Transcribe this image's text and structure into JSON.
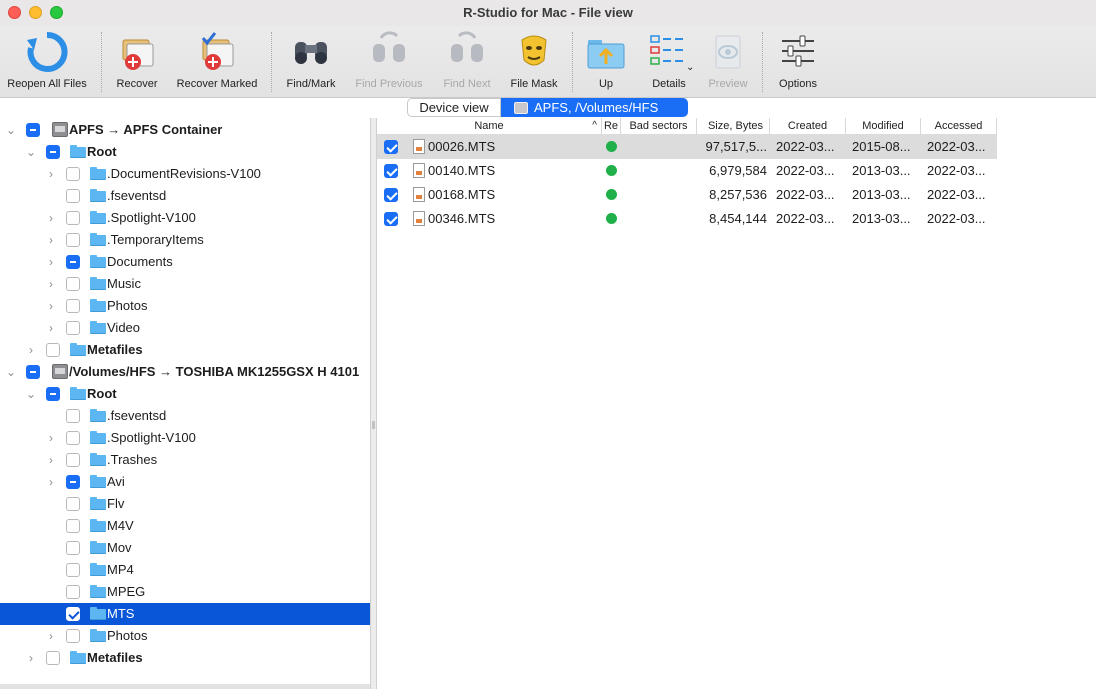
{
  "window": {
    "title": "R-Studio for Mac - File view"
  },
  "toolbar": {
    "reopen_all_files": "Reopen All Files",
    "recover": "Recover",
    "recover_marked": "Recover Marked",
    "find_mark": "Find/Mark",
    "find_previous": "Find Previous",
    "find_next": "Find Next",
    "file_mask": "File Mask",
    "up": "Up",
    "details": "Details",
    "preview": "Preview",
    "options": "Options"
  },
  "tabs": {
    "device_view": "Device view",
    "apfs_volume": "APFS, /Volumes/HFS"
  },
  "tree": [
    {
      "label": "APFS → APFS Container",
      "bold": true,
      "icon": "drive-icon",
      "level": 0,
      "expanded": true,
      "check": "mixed"
    },
    {
      "label": "Root",
      "bold": true,
      "icon": "folder-icon",
      "level": 1,
      "expanded": true,
      "check": "mixed"
    },
    {
      "label": ".DocumentRevisions-V100",
      "icon": "folder-icon",
      "level": 2,
      "expanded": false,
      "check": "none"
    },
    {
      "label": ".fseventsd",
      "icon": "folder-icon",
      "level": 2,
      "check": "none"
    },
    {
      "label": ".Spotlight-V100",
      "icon": "folder-icon",
      "level": 2,
      "expanded": false,
      "check": "none"
    },
    {
      "label": ".TemporaryItems",
      "icon": "folder-icon",
      "level": 2,
      "expanded": false,
      "check": "none"
    },
    {
      "label": "Documents",
      "icon": "folder-icon",
      "level": 2,
      "expanded": false,
      "check": "mixed"
    },
    {
      "label": "Music",
      "icon": "folder-icon",
      "level": 2,
      "expanded": false,
      "check": "none"
    },
    {
      "label": "Photos",
      "icon": "folder-icon",
      "level": 2,
      "expanded": false,
      "check": "none"
    },
    {
      "label": "Video",
      "icon": "folder-icon",
      "level": 2,
      "expanded": false,
      "check": "none"
    },
    {
      "label": "Metafiles",
      "bold": true,
      "icon": "folder-icon",
      "level": 1,
      "expanded": false,
      "check": "none"
    },
    {
      "label": "/Volumes/HFS → TOSHIBA MK1255GSX H 4101",
      "bold": true,
      "icon": "drive-icon",
      "level": 0,
      "expanded": true,
      "check": "mixed"
    },
    {
      "label": "Root",
      "bold": true,
      "icon": "folder-icon",
      "level": 1,
      "expanded": true,
      "check": "mixed"
    },
    {
      "label": ".fseventsd",
      "icon": "folder-icon",
      "level": 2,
      "check": "none"
    },
    {
      "label": ".Spotlight-V100",
      "icon": "folder-icon",
      "level": 2,
      "expanded": false,
      "check": "none"
    },
    {
      "label": ".Trashes",
      "icon": "folder-icon",
      "level": 2,
      "expanded": false,
      "check": "none"
    },
    {
      "label": "Avi",
      "icon": "folder-icon",
      "level": 2,
      "expanded": false,
      "check": "mixed"
    },
    {
      "label": "Flv",
      "icon": "folder-icon",
      "level": 2,
      "check": "none"
    },
    {
      "label": "M4V",
      "icon": "folder-icon",
      "level": 2,
      "check": "none"
    },
    {
      "label": "Mov",
      "icon": "folder-icon",
      "level": 2,
      "check": "none"
    },
    {
      "label": "MP4",
      "icon": "folder-icon",
      "level": 2,
      "check": "none"
    },
    {
      "label": "MPEG",
      "icon": "folder-icon",
      "level": 2,
      "check": "none"
    },
    {
      "label": "MTS",
      "icon": "folder-icon",
      "level": 2,
      "check": "checked",
      "selected": true
    },
    {
      "label": "Photos",
      "icon": "folder-icon",
      "level": 2,
      "expanded": false,
      "check": "none"
    },
    {
      "label": "Metafiles",
      "bold": true,
      "icon": "folder-icon",
      "level": 1,
      "expanded": false,
      "check": "none"
    }
  ],
  "files": {
    "columns": [
      "Name",
      "Re",
      "Bad sectors",
      "Size, Bytes",
      "Created",
      "Modified",
      "Accessed"
    ],
    "sort_indicator": "^",
    "rows": [
      {
        "name": "00026.MTS",
        "size": "97,517,5...",
        "created": "2022-03...",
        "modified": "2015-08...",
        "accessed": "2022-03...",
        "checked": true,
        "status": "green"
      },
      {
        "name": "00140.MTS",
        "size": "6,979,584",
        "created": "2022-03...",
        "modified": "2013-03...",
        "accessed": "2022-03...",
        "checked": true,
        "status": "green"
      },
      {
        "name": "00168.MTS",
        "size": "8,257,536",
        "created": "2022-03...",
        "modified": "2013-03...",
        "accessed": "2022-03...",
        "checked": true,
        "status": "green"
      },
      {
        "name": "00346.MTS",
        "size": "8,454,144",
        "created": "2022-03...",
        "modified": "2013-03...",
        "accessed": "2022-03...",
        "checked": true,
        "status": "green"
      }
    ]
  },
  "colors": {
    "accent": "#1a6ef5",
    "selection": "#0a56d8",
    "folder": "#5cb6f2",
    "status_ok": "#20b04a"
  }
}
